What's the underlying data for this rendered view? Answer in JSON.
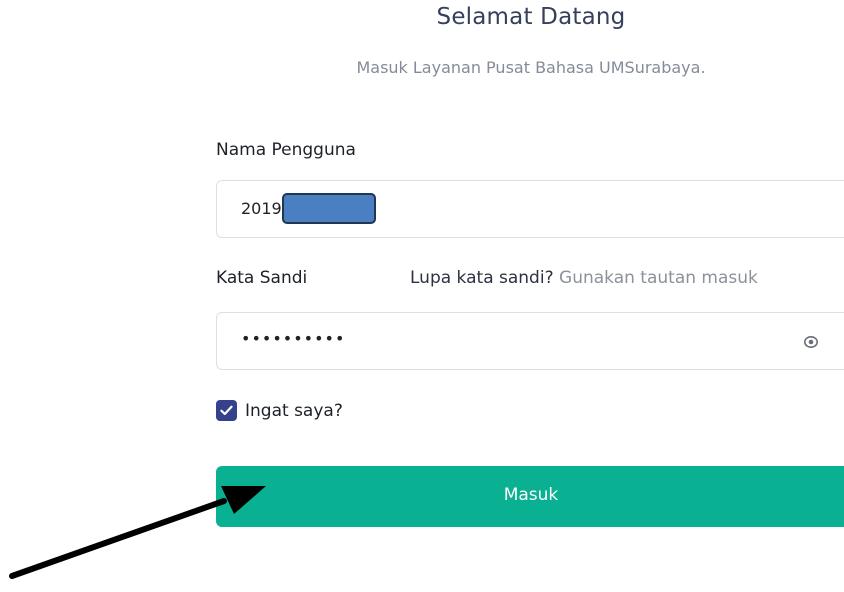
{
  "header": {
    "title": "Selamat Datang",
    "subtitle": "Masuk Layanan Pusat Bahasa UMSurabaya."
  },
  "form": {
    "username": {
      "label": "Nama Pengguna",
      "value": "2019"
    },
    "password": {
      "label": "Kata Sandi",
      "masked_value": "••••••••••",
      "forgot_text": "Lupa kata sandi?",
      "forgot_link": "Gunakan tautan masuk",
      "toggle_icon": "eye-icon"
    },
    "remember": {
      "label": "Ingat saya?",
      "checked": true
    },
    "submit_label": "Masuk"
  },
  "colors": {
    "accent": "#0ab092",
    "title": "#35405d",
    "checkbox": "#36418b",
    "redaction": "#4a7fc1"
  }
}
